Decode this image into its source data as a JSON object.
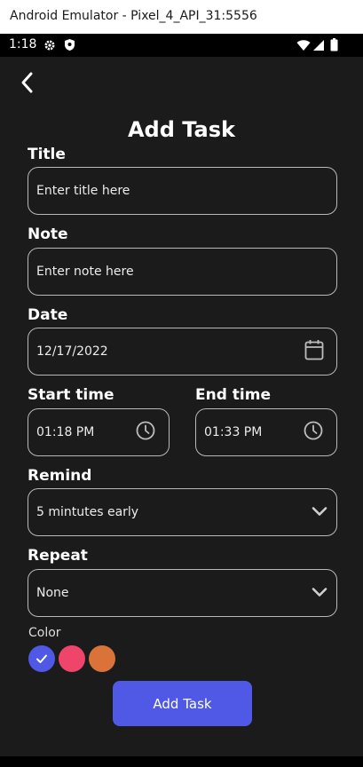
{
  "window": {
    "title": "Android Emulator - Pixel_4_API_31:5556"
  },
  "status_bar": {
    "time": "1:18"
  },
  "page": {
    "title": "Add Task"
  },
  "form": {
    "title": {
      "label": "Title",
      "placeholder": "Enter title here"
    },
    "note": {
      "label": "Note",
      "placeholder": "Enter note here"
    },
    "date": {
      "label": "Date",
      "value": "12/17/2022"
    },
    "start_time": {
      "label": "Start time",
      "value": "01:18 PM"
    },
    "end_time": {
      "label": "End time",
      "value": "01:33 PM"
    },
    "remind": {
      "label": "Remind",
      "value": "5 mintutes early"
    },
    "repeat": {
      "label": "Repeat",
      "value": "None"
    },
    "color": {
      "label": "Color",
      "options": [
        "#4f59e5",
        "#f0456a",
        "#d9733a"
      ],
      "selected_index": 0
    }
  },
  "actions": {
    "add_task_label": "Add Task"
  },
  "icons": [
    "settings-icon",
    "shield-icon",
    "wifi-icon",
    "signal-icon",
    "battery-icon",
    "back-arrow-icon",
    "calendar-icon",
    "clock-icon",
    "chevron-down-icon",
    "checkmark-icon"
  ]
}
